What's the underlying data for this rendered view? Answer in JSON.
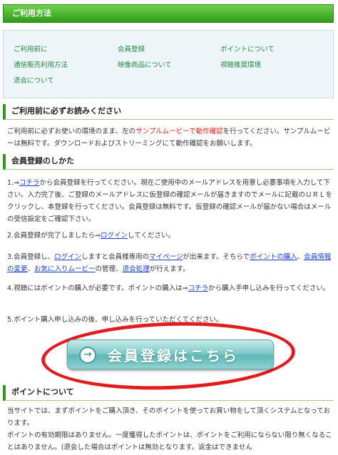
{
  "header": {
    "title": "ご利用方法"
  },
  "nav": {
    "items": [
      "ご利用前に",
      "会員登録",
      "ポイントについて",
      "通信販売利用方法",
      "映像商品について",
      "視聴推奨環境",
      "退会について"
    ]
  },
  "sec1": {
    "heading": "ご利用前に必ずお読みください",
    "p1a": "ご利用前に必ずお使いの環境のまま、左の",
    "p1b": "サンプルムービーで動作確認",
    "p1c": "を行ってください。サンプルムービーは無料です。ダウンロードおよびストリーミングにて動作確認をお願いします。"
  },
  "sec2": {
    "heading": "会員登録のしかた",
    "s1a": "1.⇒",
    "s1link": "コチラ",
    "s1b": "から会員登録を行ってください。現在ご使用中のメールアドレスを用意し必要事項を入力して下さい。入力完了後、ご登録のメールアドレスに仮登録の確認メールが届きますのでメールに記載のＵＲＬをクリックし、本登録を行ってください。会員登録は無料です。仮登録の確認メールが届かない場合はメールの受信設定をご確認下さい。",
    "s2a": "2.会員登録が完了しましたら⇒",
    "s2link": "ログイン",
    "s2b": "してください。",
    "s3a": "3.会員登録し、",
    "s3link1": "ログイン",
    "s3b": "しますと会員様専用の",
    "s3link2": "マイページ",
    "s3c": "が出来ます。そちらで",
    "s3link3": "ポイントの購入",
    "s3d": "、",
    "s3link4": "会員情報の変更",
    "s3e": "、",
    "s3link5": "お気に入りムービー",
    "s3f": "の管理、",
    "s3link6": "退会処理",
    "s3g": "が行えます。",
    "s4a": "4.視聴にはポイントの購入が必要です。ポイントの購入は⇒",
    "s4link": "コチラ",
    "s4b": "から購入手申し込みを行ってください。",
    "s5": "5.ポイント購入申し込みの後、申し込みを行っていただくてください。"
  },
  "register_button": {
    "label": "会員登録はこちら"
  },
  "sec3": {
    "heading": "ポイントについて",
    "p1": "当サイトでは、まずポイントをご購入頂き、そのポイントを使ってお買い物をして頂くシステムとなっております。",
    "p2": "ポイントの有効期限はありません。一度獲得したポイントは、ポイントをご利用にならない限り無くなることはありません。(退会した場合はポイントは無効となります。返金はできません"
  }
}
